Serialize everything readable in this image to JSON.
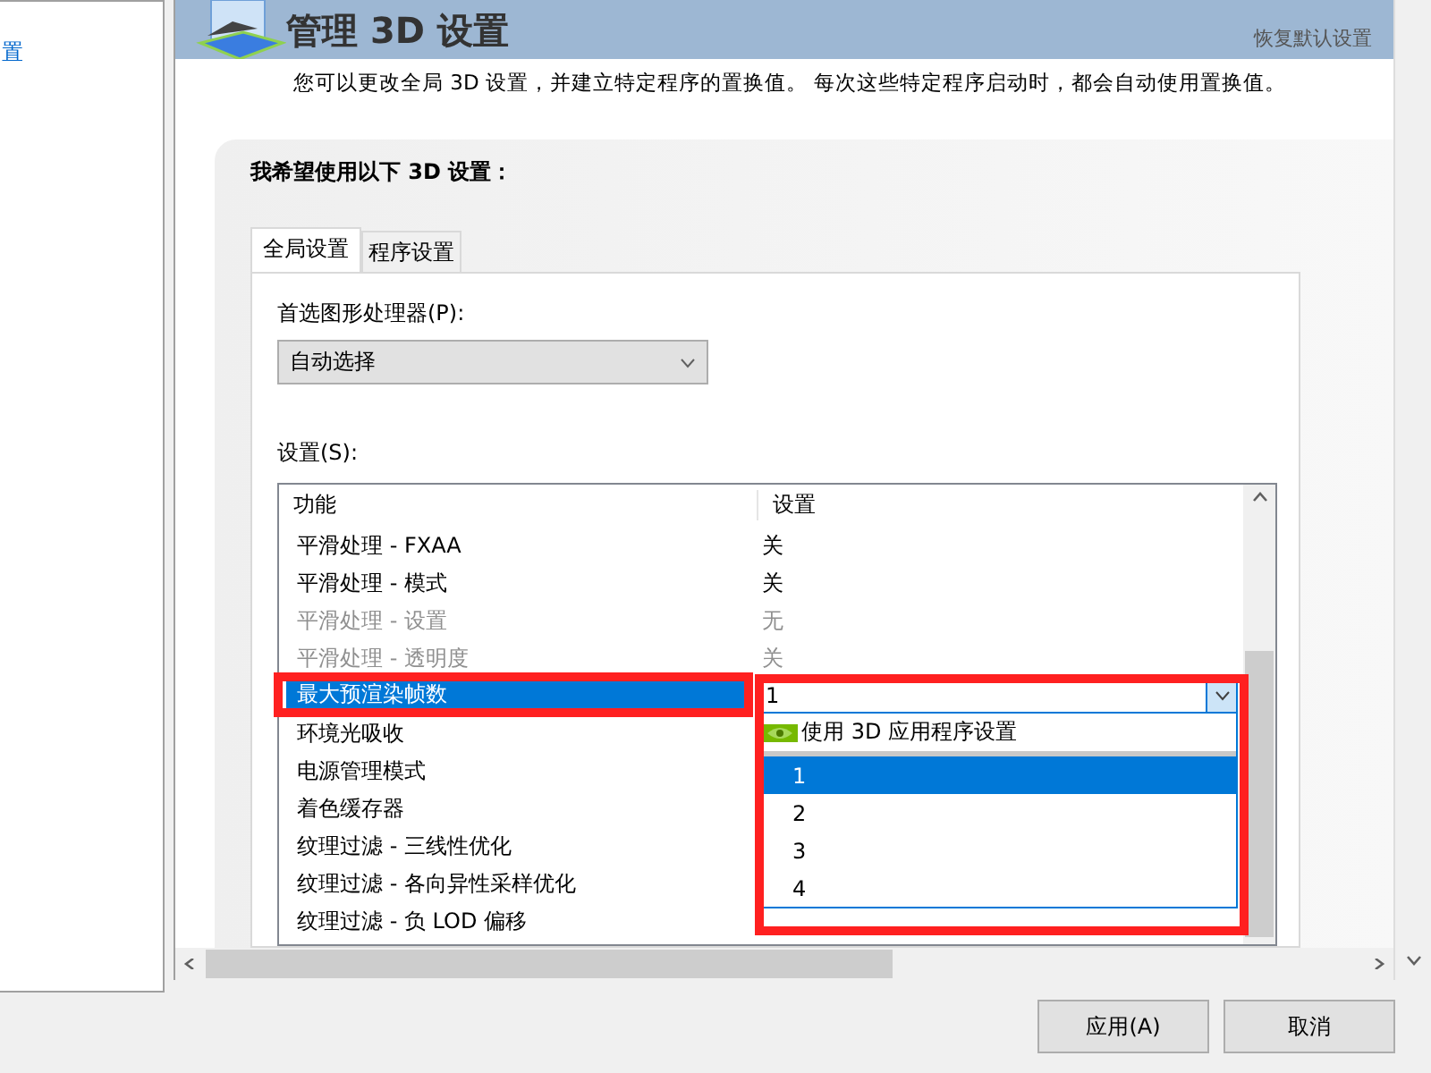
{
  "sidebar": {
    "items": [
      {
        "label": "置",
        "selected": false
      }
    ]
  },
  "header": {
    "title": "管理 3D 设置",
    "restore_link": "恢复默认设置"
  },
  "description": "您可以更改全局 3D 设置，并建立特定程序的置换值。 每次这些特定程序启动时，都会自动使用置换值。",
  "panel": {
    "heading": "我希望使用以下 3D 设置：",
    "tabs": [
      {
        "label": "全局设置",
        "selected": true
      },
      {
        "label": "程序设置",
        "selected": false
      }
    ],
    "gpu_label": "首选图形处理器(P):",
    "gpu_select": {
      "value": "自动选择"
    },
    "settings_label": "设置(S):",
    "table": {
      "columns": [
        "功能",
        "设置"
      ],
      "rows": [
        {
          "feature": "平滑处理 - FXAA",
          "value": "关",
          "disabled": false,
          "selected": false
        },
        {
          "feature": "平滑处理 - 模式",
          "value": "关",
          "disabled": false,
          "selected": false
        },
        {
          "feature": "平滑处理 - 设置",
          "value": "无",
          "disabled": true,
          "selected": false
        },
        {
          "feature": "平滑处理 - 透明度",
          "value": "关",
          "disabled": true,
          "selected": false
        },
        {
          "feature": "最大预渲染帧数",
          "value": "1",
          "disabled": false,
          "selected": true
        },
        {
          "feature": "环境光吸收",
          "disabled": false,
          "selected": false
        },
        {
          "feature": "电源管理模式",
          "disabled": false,
          "selected": false
        },
        {
          "feature": "着色缓存器",
          "disabled": false,
          "selected": false
        },
        {
          "feature": "纹理过滤 - 三线性优化",
          "disabled": false,
          "selected": false
        },
        {
          "feature": "纹理过滤 - 各向异性采样优化",
          "disabled": false,
          "selected": false
        },
        {
          "feature": "纹理过滤 - 负 LOD 偏移",
          "disabled": false,
          "selected": false
        }
      ],
      "dropdown": [
        {
          "label": "使用 3D 应用程序设置",
          "kind": "app",
          "selected": false
        },
        {
          "label": "1",
          "kind": "plain",
          "selected": true
        },
        {
          "label": "2",
          "kind": "plain",
          "selected": false
        },
        {
          "label": "3",
          "kind": "plain",
          "selected": false
        },
        {
          "label": "4",
          "kind": "plain",
          "selected": false
        }
      ]
    }
  },
  "buttons": [
    {
      "label": "应用(A)"
    },
    {
      "label": "取消"
    }
  ]
}
